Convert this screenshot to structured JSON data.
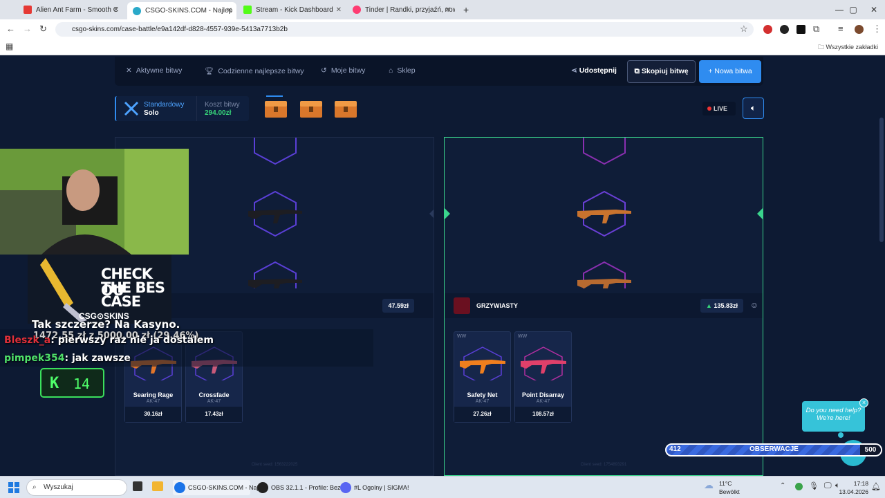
{
  "browser": {
    "tabs": [
      {
        "title": "Alien Ant Farm - Smooth C",
        "favicon_color": "#e53935",
        "active": false
      },
      {
        "title": "CSGO-SKINS.COM - Najlep",
        "favicon_color": "#2aa9c9",
        "active": true
      },
      {
        "title": "Stream - Kick Dashboard",
        "favicon_color": "#53fc18",
        "active": false
      },
      {
        "title": "Tinder | Randki, przyjaźń, nowe",
        "favicon_color": "#fe3c72",
        "active": false
      }
    ],
    "url": "csgo-skins.com/case-battle/e9a142df-d828-4557-939e-5413a7713b2b",
    "bookmarks_all": "Wszystkie zakładki"
  },
  "site": {
    "nav": {
      "active_battles": "Aktywne bitwy",
      "daily_best": "Codzienne najlepsze bitwy",
      "my_battles": "Moje bitwy",
      "shop": "Sklep",
      "share": "Udostępnij",
      "copy_battle": "Skopiuj bitwę",
      "new_battle": "Nowa bitwa"
    },
    "battle": {
      "mode": "Standardowy",
      "type": "Solo",
      "cost_label": "Koszt bitwy",
      "cost_value": "294.00zł",
      "live": "LIVE"
    },
    "left_player": {
      "total": "47.59zł",
      "client_seed": "Client seed: 1563222025",
      "items": [
        {
          "condition": "FT",
          "name": "Searing Rage",
          "type": "AK-47",
          "price": "30.16zł"
        },
        {
          "condition": "FT",
          "name": "Crossfade",
          "type": "AK-47",
          "price": "17.43zł"
        }
      ]
    },
    "right_player": {
      "name": "GRZYWIASTY",
      "total": "135.83zł",
      "client_seed": "Client seed: 1754893291",
      "items": [
        {
          "condition": "WW",
          "name": "Safety Net",
          "type": "AK-47",
          "price": "27.26zł"
        },
        {
          "condition": "WW",
          "name": "Point Disarray",
          "type": "AK-47",
          "price": "108.57zł"
        }
      ]
    },
    "help": {
      "bubble": "Do you need help? We're here!",
      "close": "×"
    }
  },
  "stream": {
    "promo_line1": "CHECK OU",
    "promo_line2": "THE BES",
    "promo_line3": "CASE",
    "promo_logo": "CSG⊙SKINS",
    "chat": [
      {
        "user": "",
        "text": "Tak szczerze? Na Kasyno.",
        "user_color": "#ffffff"
      },
      {
        "user": "",
        "text": "1472,55 zł z 5000,00 zł (29.46%)",
        "user_color": "#ffffff"
      },
      {
        "user": "Bleszk_a",
        "text": ": pierwszy raz nie ja dostalem",
        "user_color": "#e0303a"
      },
      {
        "user": "pimpek354",
        "text": ": jak zawsze",
        "user_color": "#4fe06a"
      }
    ],
    "kick_viewers": "14",
    "goal": {
      "current": "412",
      "label": "OBSERWACJE",
      "target": "500"
    }
  },
  "taskbar": {
    "search": "Wyszukaj",
    "apps": [
      {
        "label": "CSGO-SKINS.COM - Naj",
        "color": "#1a73e8"
      },
      {
        "label": "OBS 32.1.1 - Profile: Bez",
        "color": "#222222"
      },
      {
        "label": "#L  Ogolny | SIGMA!",
        "color": "#5865f2"
      }
    ],
    "temperature": "11°C",
    "weather": "Bewölkt",
    "time": "17:18",
    "date": "13.04.2026"
  }
}
